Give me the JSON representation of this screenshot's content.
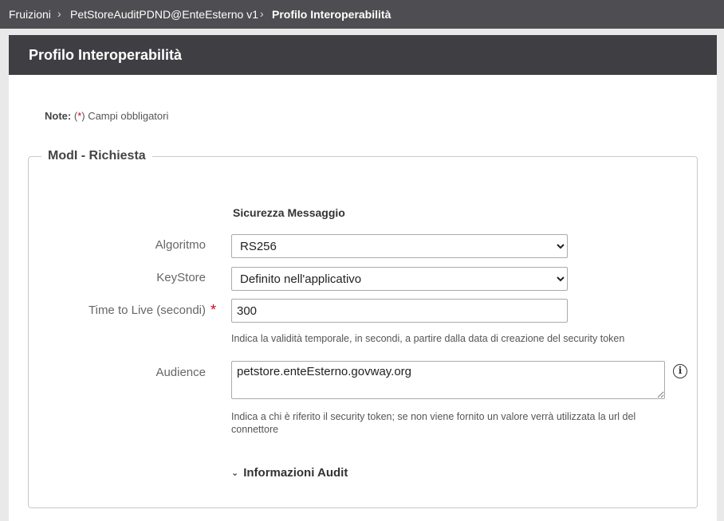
{
  "breadcrumb": {
    "items": [
      "Fruizioni",
      "PetStoreAuditPDND@EnteEsterno v1",
      "Profilo Interoperabilità"
    ],
    "separator": "›"
  },
  "panel": {
    "title": "Profilo Interoperabilità"
  },
  "note": {
    "label": "Note:",
    "open": "(",
    "star": "*",
    "text": ") Campi obbligatori"
  },
  "fieldset": {
    "legend": "ModI - Richiesta",
    "section_title": "Sicurezza Messaggio",
    "algoritmo": {
      "label": "Algoritmo",
      "value": "RS256"
    },
    "keystore": {
      "label": "KeyStore",
      "value": "Definito nell'applicativo"
    },
    "ttl": {
      "label": "Time to Live (secondi)",
      "required_mark": "*",
      "value": "300",
      "help": "Indica la validità temporale, in secondi, a partire dalla data di creazione del security token"
    },
    "audience": {
      "label": "Audience",
      "value": "petstore.enteEsterno.govway.org",
      "help": "Indica a chi è riferito il security token; se non viene fornito un valore verrà utilizzata la url del connettore",
      "info_icon": "info-icon"
    },
    "audit": {
      "label": "Informazioni Audit",
      "icon": "chevron-down-icon"
    }
  },
  "colors": {
    "header": "#3f3f43",
    "breadcrumb": "#4e4e52",
    "required": "#d0021b"
  }
}
